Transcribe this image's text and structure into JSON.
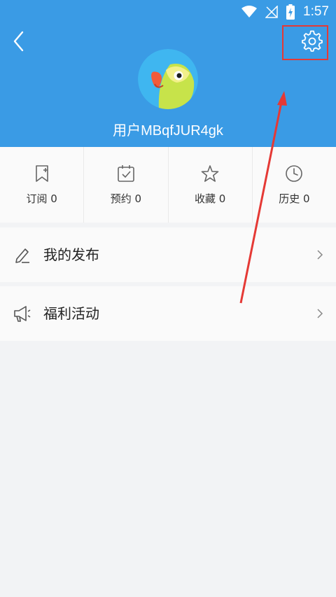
{
  "status_bar": {
    "time": "1:57"
  },
  "profile": {
    "username": "用户MBqfJUR4gk"
  },
  "stats": [
    {
      "label": "订阅",
      "count": "0"
    },
    {
      "label": "预约",
      "count": "0"
    },
    {
      "label": "收藏",
      "count": "0"
    },
    {
      "label": "历史",
      "count": "0"
    }
  ],
  "menu": [
    {
      "label": "我的发布"
    },
    {
      "label": "福利活动"
    }
  ],
  "colors": {
    "header": "#3a9be5",
    "annotation": "#e53935"
  }
}
